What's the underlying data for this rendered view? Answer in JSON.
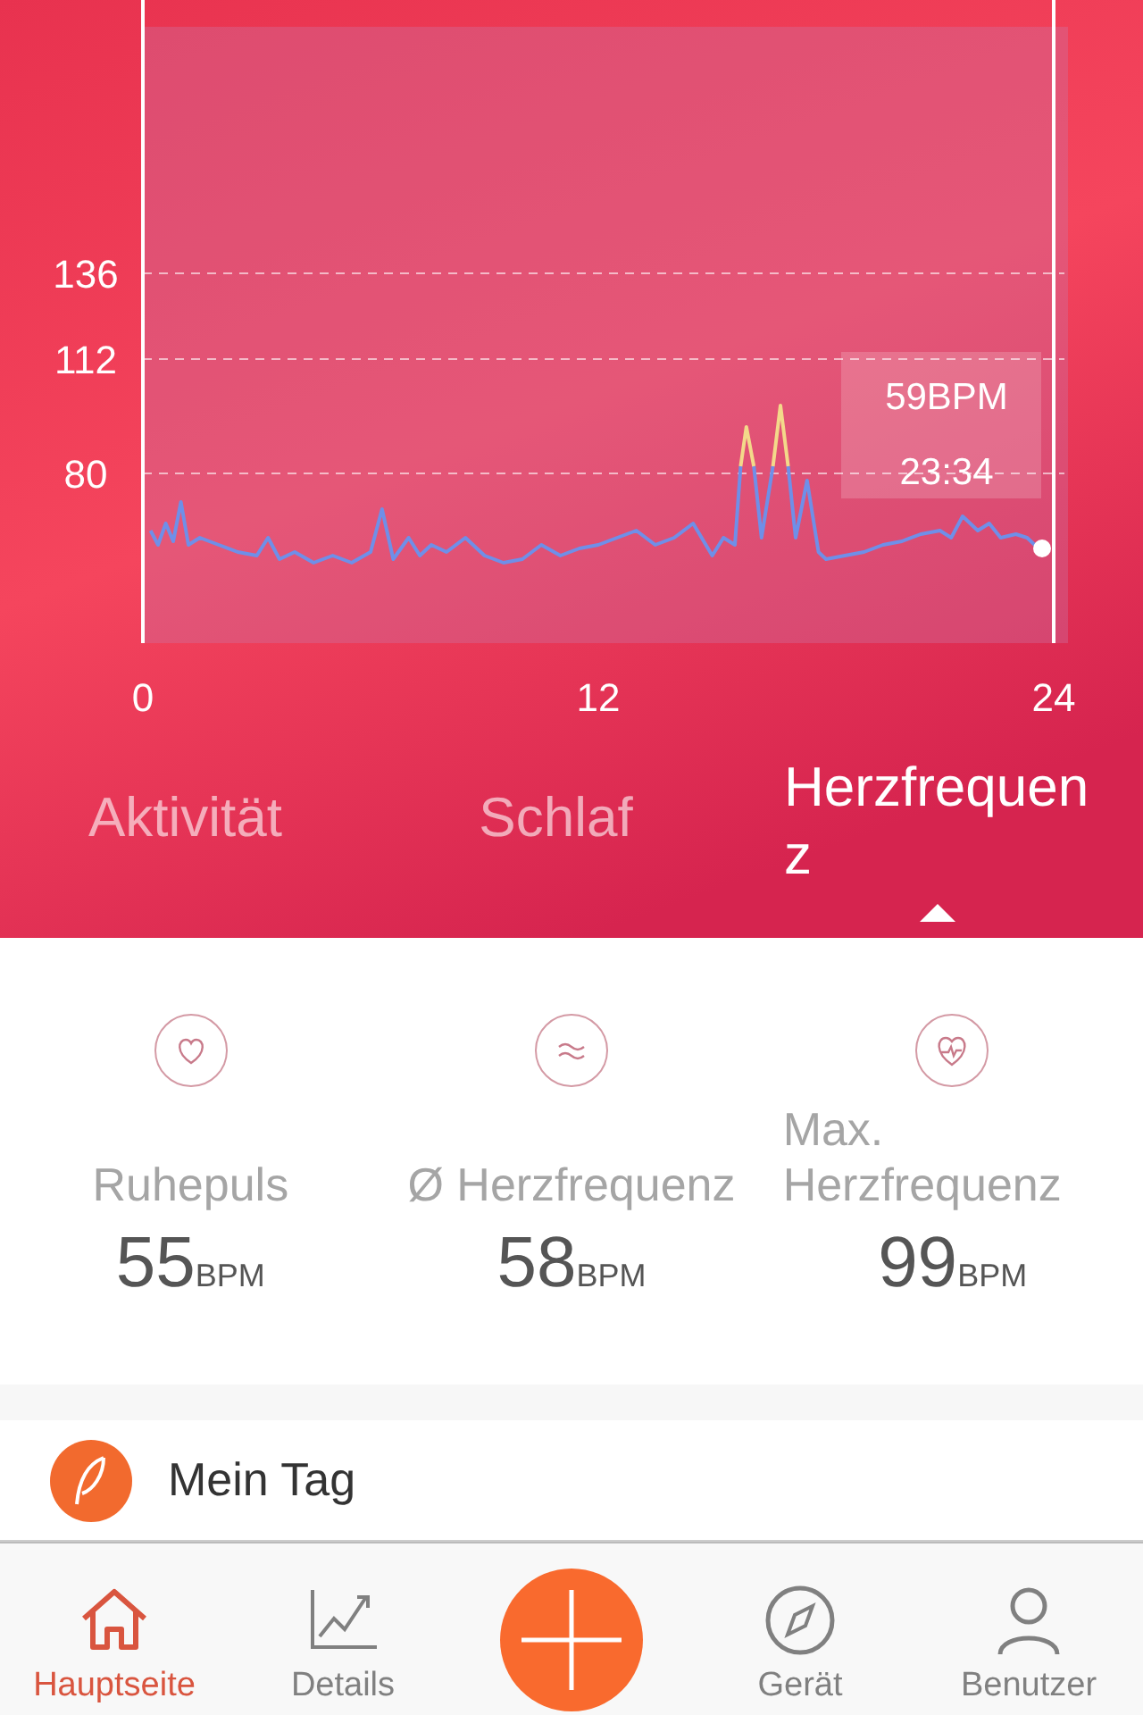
{
  "chart": {
    "chart_data": {
      "type": "line",
      "grid": true,
      "xlim": [
        0,
        24
      ],
      "ylim": [
        32.5,
        205
      ],
      "xticks": [
        0,
        12,
        24
      ],
      "yticks": [
        80,
        112,
        136
      ],
      "x": [
        0.2,
        0.4,
        0.6,
        0.8,
        1.0,
        1.2,
        1.5,
        2,
        2.5,
        3,
        3.3,
        3.6,
        4,
        4.5,
        5,
        5.5,
        6,
        6.3,
        6.6,
        7,
        7.3,
        7.6,
        8,
        8.5,
        9,
        9.5,
        10,
        10.5,
        11,
        11.5,
        12,
        12.5,
        13,
        13.5,
        14,
        14.5,
        15,
        15.3,
        15.6,
        15.75,
        15.9,
        16.1,
        16.3,
        16.6,
        16.8,
        17.0,
        17.2,
        17.5,
        17.8,
        18,
        18.5,
        19,
        19.5,
        20,
        20.5,
        21,
        21.3,
        21.6,
        22,
        22.3,
        22.6,
        23,
        23.3,
        23.6
      ],
      "series": [
        {
          "color": "#6f8fe8",
          "values": [
            64,
            60,
            66,
            61,
            72,
            60,
            62,
            60,
            58,
            57,
            62,
            56,
            58,
            55,
            57,
            55,
            58,
            70,
            56,
            62,
            57,
            60,
            58,
            62,
            57,
            55,
            56,
            60,
            57,
            59,
            60,
            62,
            64,
            60,
            62,
            66,
            57,
            62,
            60,
            82,
            null,
            82,
            62,
            82,
            null,
            82,
            62,
            78,
            58,
            56,
            57,
            58,
            60,
            61,
            63,
            64,
            62,
            68,
            64,
            66,
            62,
            63,
            62,
            59
          ]
        },
        {
          "color": "#f3d98a",
          "values": [
            null,
            null,
            null,
            null,
            null,
            null,
            null,
            null,
            null,
            null,
            null,
            null,
            null,
            null,
            null,
            null,
            null,
            null,
            null,
            null,
            null,
            null,
            null,
            null,
            null,
            null,
            null,
            null,
            null,
            null,
            null,
            null,
            null,
            null,
            null,
            null,
            null,
            null,
            null,
            82,
            93,
            82,
            null,
            82,
            99,
            82,
            null,
            null,
            null,
            null,
            null,
            null,
            null,
            null,
            null,
            null,
            null,
            null,
            null,
            null,
            null,
            null,
            null,
            null
          ]
        }
      ]
    },
    "tooltip": {
      "value": "59BPM",
      "time": "23:34"
    }
  },
  "tabs": [
    {
      "label": "Aktivität",
      "selected": false
    },
    {
      "label": "Schlaf",
      "selected": false
    },
    {
      "label": "Herzfrequenz",
      "selected": true
    }
  ],
  "stats": [
    {
      "kind": "heart",
      "label": "Ruhepuls",
      "value": "55",
      "unit": "BPM"
    },
    {
      "kind": "wave",
      "label": "Ø Herzfrequenz",
      "value": "58",
      "unit": "BPM"
    },
    {
      "kind": "pulse",
      "label": "Max. Herzfrequenz",
      "value": "99",
      "unit": "BPM"
    }
  ],
  "my_day": {
    "label": "Mein Tag"
  },
  "nav": [
    {
      "kind": "home",
      "label": "Hauptseite",
      "selected": true
    },
    {
      "kind": "chart",
      "label": "Details",
      "selected": false
    },
    {
      "kind": "add"
    },
    {
      "kind": "compass",
      "label": "Gerät",
      "selected": false
    },
    {
      "kind": "user",
      "label": "Benutzer",
      "selected": false
    }
  ]
}
